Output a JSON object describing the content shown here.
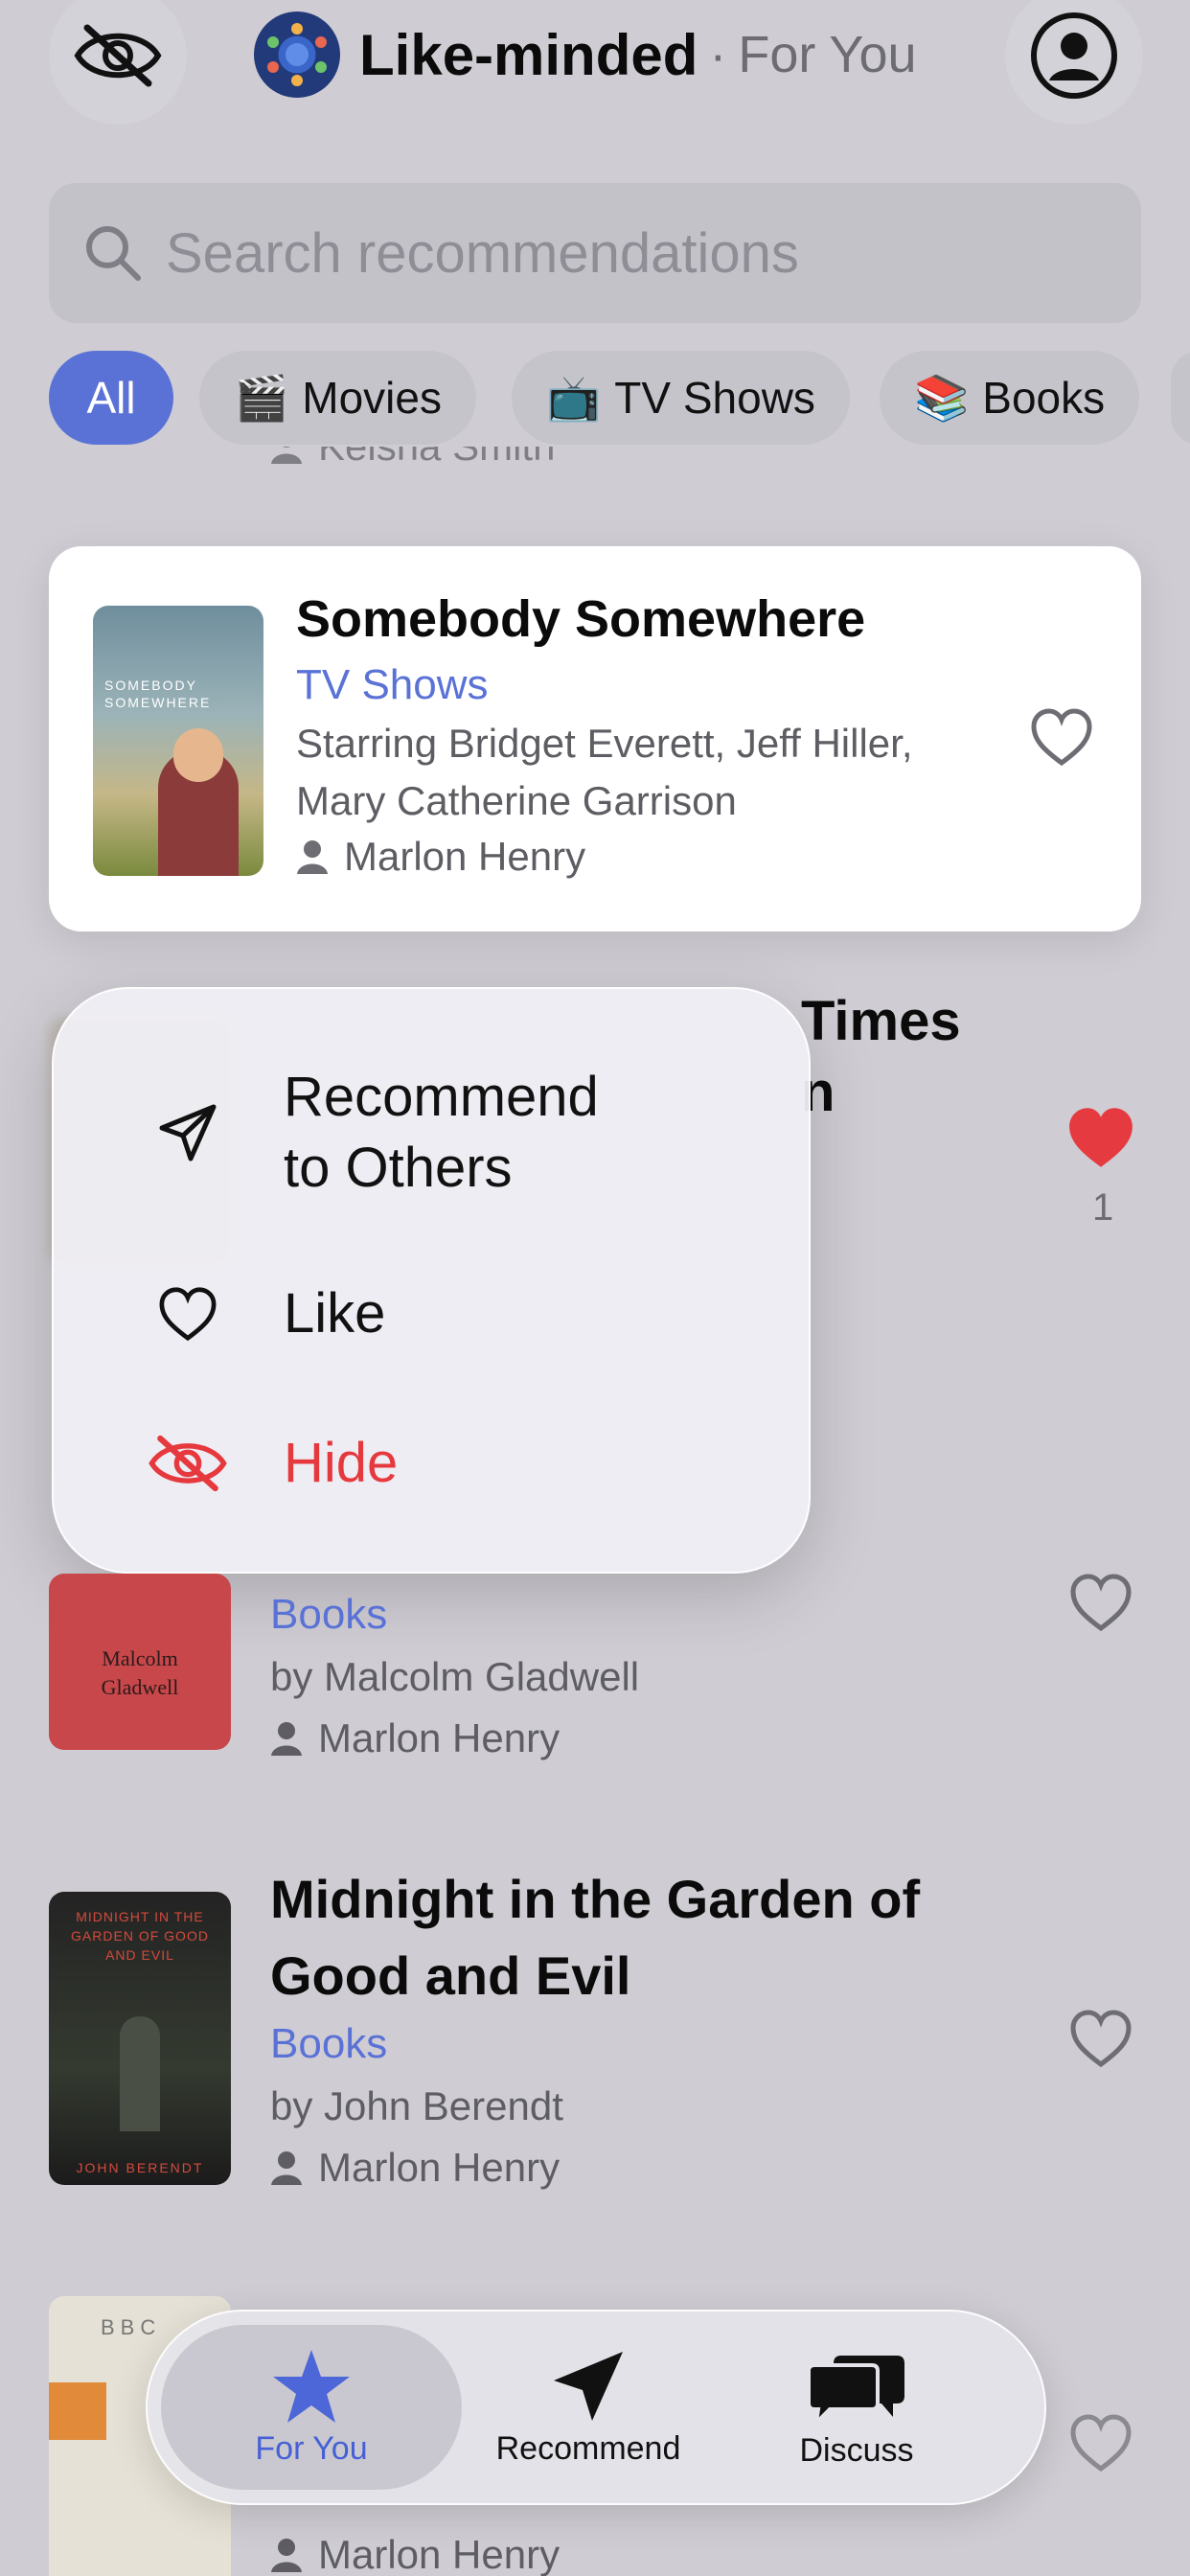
{
  "header": {
    "app_name": "Like-minded",
    "separator": "·",
    "section": "For You"
  },
  "search": {
    "placeholder": "Search recommendations"
  },
  "filters": [
    {
      "label": "All",
      "emoji": ""
    },
    {
      "label": "Movies",
      "emoji": "🎬"
    },
    {
      "label": "TV Shows",
      "emoji": "📺"
    },
    {
      "label": "Books",
      "emoji": "📚"
    }
  ],
  "cut_row": {
    "user": "Keisha Smith"
  },
  "featured": {
    "title": "Somebody Somewhere",
    "category": "TV Shows",
    "line1": "Starring Bridget Everett, Jeff Hiller,",
    "line2": "Mary Catherine Garrison",
    "user": "Marlon Henry",
    "poster_text": "SOMEBODY SOMEWHERE"
  },
  "behind_row": {
    "title_part": "Times",
    "title_part2": "n",
    "like_count": "1"
  },
  "menu": {
    "items": [
      {
        "label_line1": "Recommend",
        "label_line2": "to Others",
        "icon": "send-icon"
      },
      {
        "label": "Like",
        "icon": "heart-icon"
      },
      {
        "label": "Hide",
        "icon": "eye-slash-icon",
        "color": "#e5393e"
      }
    ]
  },
  "rows": [
    {
      "category": "Books",
      "byline": "by Malcolm Gladwell",
      "user": "Marlon Henry",
      "poster_text": "Malcolm Gladwell"
    },
    {
      "title_line1": "Midnight in the Garden of",
      "title_line2": "Good and Evil",
      "category": "Books",
      "byline": "by John Berendt",
      "user": "Marlon Henry",
      "poster_text": "MIDNIGHT IN THE GARDEN OF GOOD AND EVIL",
      "poster_author": "JOHN BERENDT"
    },
    {
      "user": "Marlon Henry",
      "poster_text": "BBC"
    }
  ],
  "tabbar": {
    "tabs": [
      {
        "label": "For You",
        "icon": "star-icon"
      },
      {
        "label": "Recommend",
        "icon": "send-icon"
      },
      {
        "label": "Discuss",
        "icon": "chat-bubbles-icon"
      }
    ]
  },
  "colors": {
    "accent": "#5a72d6",
    "danger": "#e5393e",
    "liked": "#e53a3f"
  }
}
